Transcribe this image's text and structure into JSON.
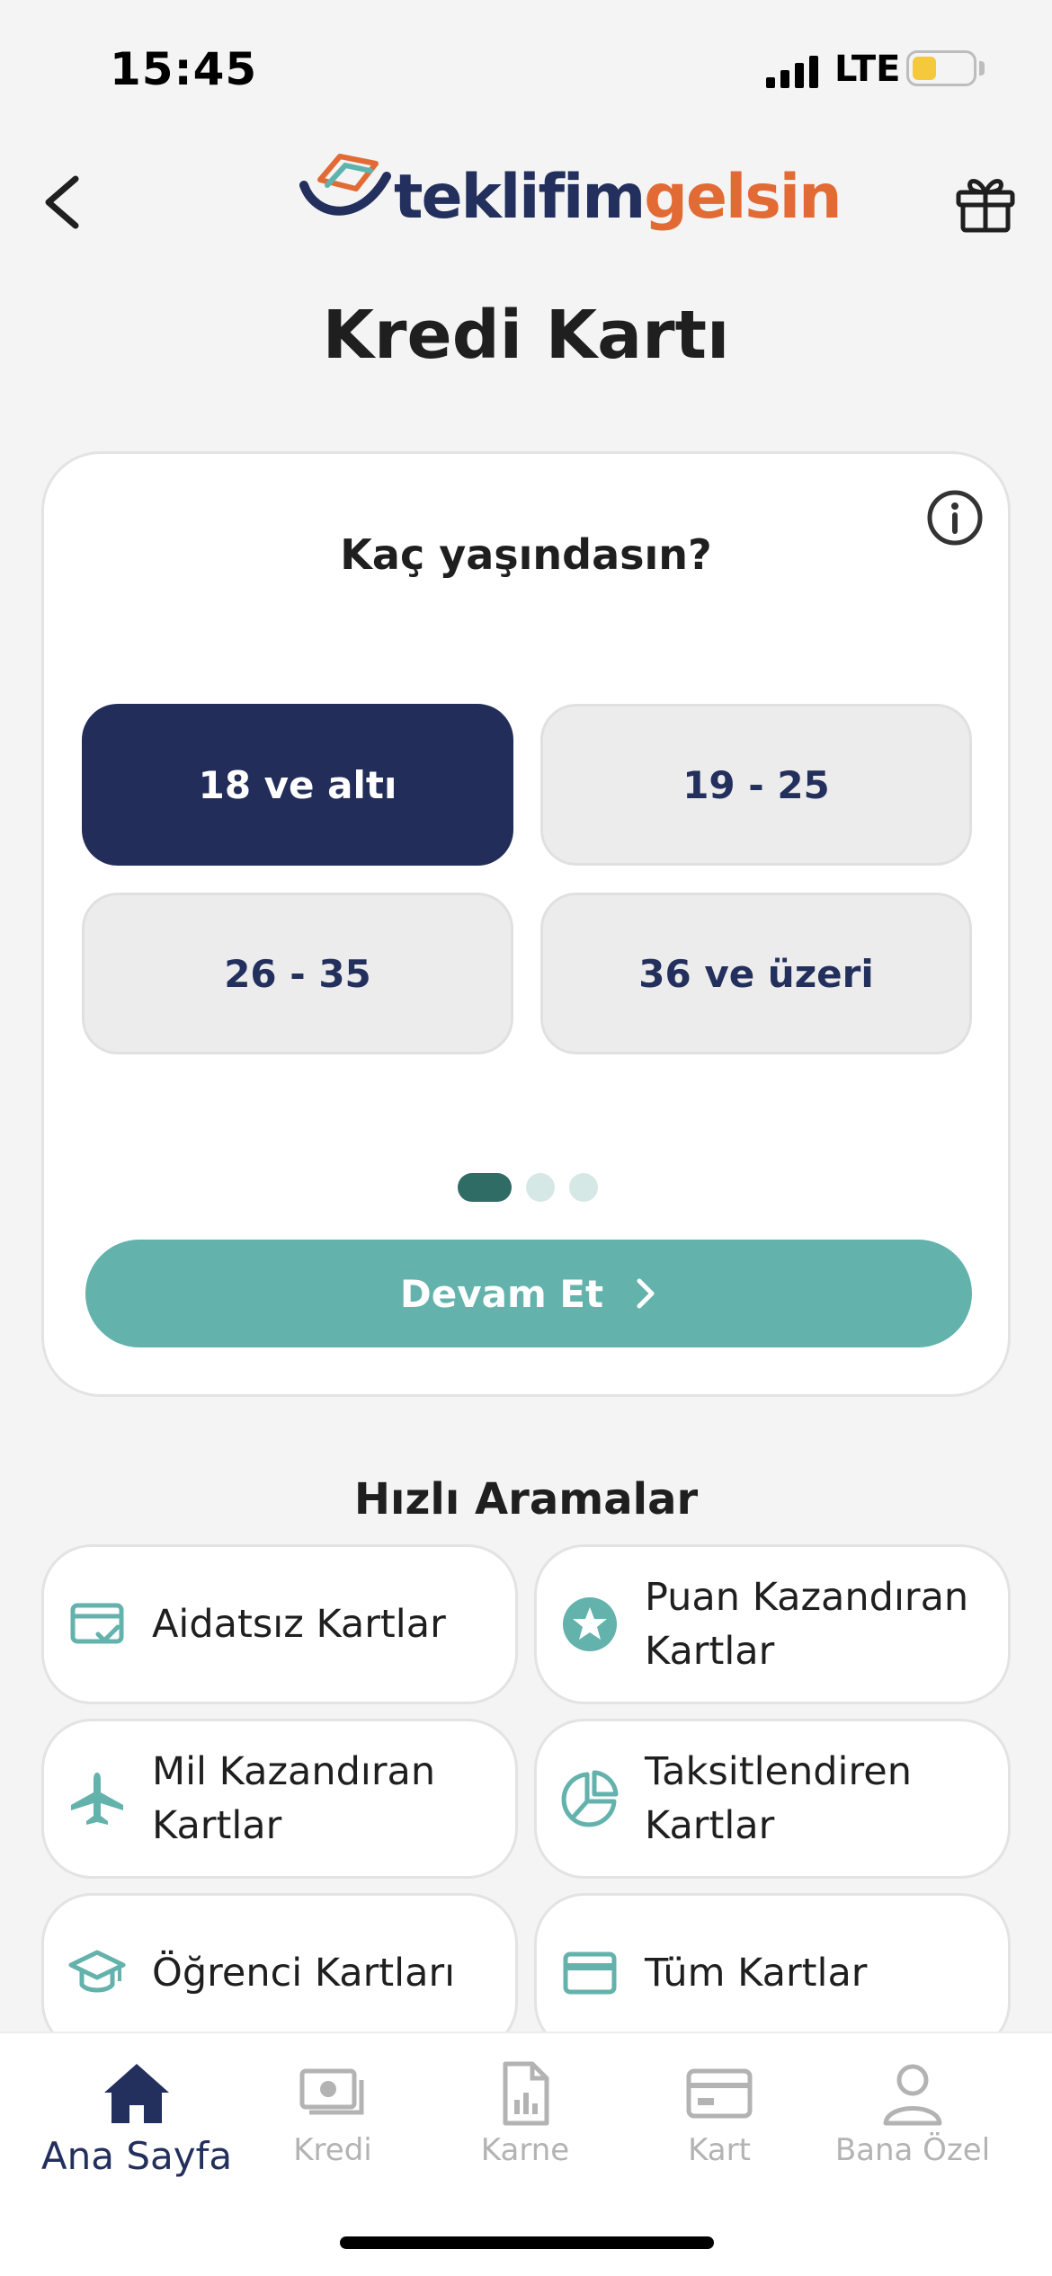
{
  "status_bar": {
    "time": "15:45",
    "network": "LTE"
  },
  "header": {
    "logo_part1": "teklifim",
    "logo_part2": "gelsin",
    "title": "Kredi Kartı"
  },
  "form": {
    "question": "Kaç yaşındasın?",
    "options": [
      {
        "label": "18 ve altı",
        "selected": true
      },
      {
        "label": "19 - 25",
        "selected": false
      },
      {
        "label": "26 - 35",
        "selected": false
      },
      {
        "label": "36 ve üzeri",
        "selected": false
      }
    ],
    "pager": {
      "current": 1,
      "total": 3
    },
    "continue_label": "Devam Et"
  },
  "quick_search": {
    "title": "Hızlı Aramalar",
    "items": [
      {
        "label": "Aidatsız Kartlar",
        "icon": "card-check-icon"
      },
      {
        "label": "Puan Kazandıran Kartlar",
        "icon": "star-badge-icon"
      },
      {
        "label": "Mil Kazandıran Kartlar",
        "icon": "airplane-icon"
      },
      {
        "label": "Taksitlendiren Kartlar",
        "icon": "pie-split-icon"
      },
      {
        "label": "Öğrenci Kartları",
        "icon": "graduation-cap-icon"
      },
      {
        "label": "Tüm Kartlar",
        "icon": "credit-card-icon"
      }
    ]
  },
  "tab_bar": {
    "active": "Ana Sayfa",
    "tabs": [
      {
        "label": "Ana Sayfa",
        "icon": "home-icon"
      },
      {
        "label": "Kredi",
        "icon": "money-icon"
      },
      {
        "label": "Karne",
        "icon": "report-icon"
      },
      {
        "label": "Kart",
        "icon": "card-icon"
      },
      {
        "label": "Bana Özel",
        "icon": "user-icon"
      }
    ]
  },
  "colors": {
    "navy": "#222e59",
    "teal": "#63b2ac",
    "teal_dark": "#2f6c66",
    "orange": "#e26a35",
    "background": "#f4f4f4",
    "inactive_gray": "#b3b3b3"
  }
}
